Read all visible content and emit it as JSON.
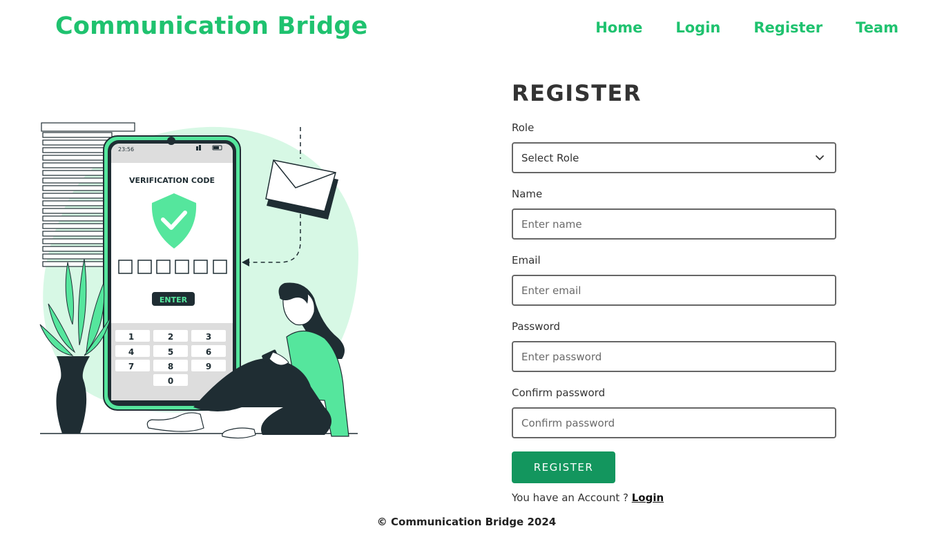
{
  "header": {
    "brand": "Communication Bridge",
    "nav": [
      "Home",
      "Login",
      "Register",
      "Team"
    ]
  },
  "illustration": {
    "phone_time": "23:56",
    "screen_title": "VERIFICATION CODE",
    "enter_label": "ENTER",
    "keypad": [
      "1",
      "2",
      "3",
      "4",
      "5",
      "6",
      "7",
      "8",
      "9",
      "0"
    ]
  },
  "form": {
    "title": "REGISTER",
    "role": {
      "label": "Role",
      "selected": "Select Role"
    },
    "name": {
      "label": "Name",
      "placeholder": "Enter name"
    },
    "email": {
      "label": "Email",
      "placeholder": "Enter email"
    },
    "password": {
      "label": "Password",
      "placeholder": "Enter password"
    },
    "confirm": {
      "label": "Confirm password",
      "placeholder": "Confirm password"
    },
    "submit_label": "REGISTER",
    "account_text": "You have an Account ?",
    "login_link": "Login"
  },
  "footer": {
    "text": "© Communication Bridge 2024"
  },
  "colors": {
    "brand": "#1fc26f",
    "button": "#13965e",
    "illustration_accent": "#55e69d",
    "illustration_light": "#d7f8e5",
    "illustration_dark": "#1f2d33"
  }
}
